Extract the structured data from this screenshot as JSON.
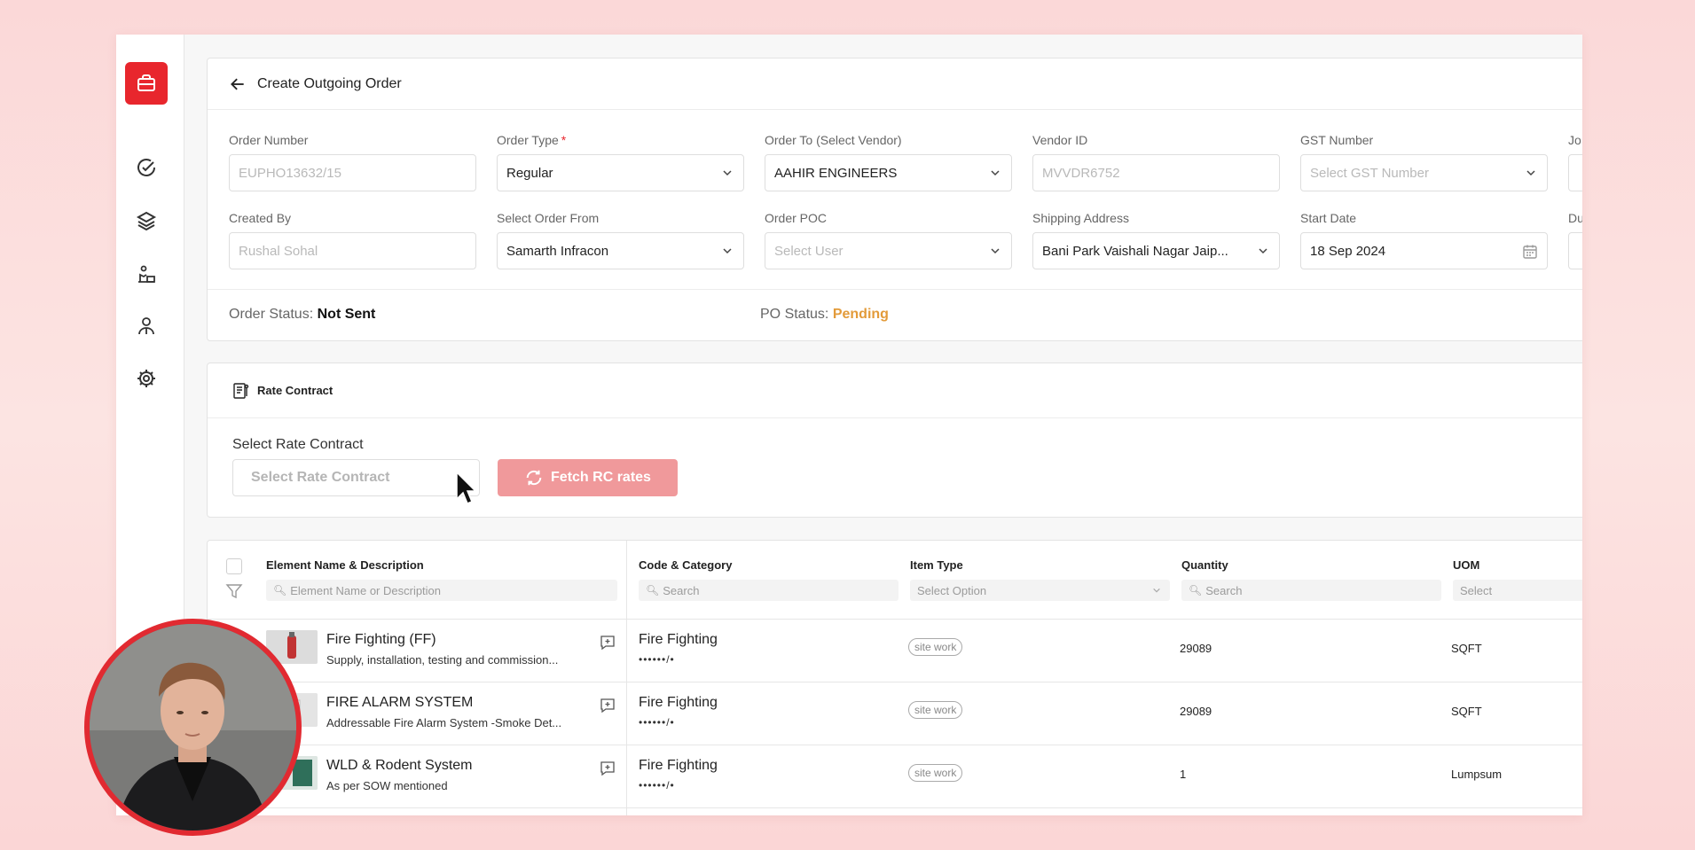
{
  "header": {
    "title": "Create Outgoing Order"
  },
  "form": {
    "order_number": {
      "label": "Order Number",
      "value": "EUPHO13632/15"
    },
    "order_type": {
      "label": "Order Type",
      "value": "Regular",
      "required_mark": "*"
    },
    "order_to": {
      "label": "Order To (Select Vendor)",
      "value": "AAHIR ENGINEERS"
    },
    "vendor_id": {
      "label": "Vendor ID",
      "value": "MVVDR6752"
    },
    "gst_number": {
      "label": "GST Number",
      "placeholder": "Select GST Number"
    },
    "created_by": {
      "label": "Created By",
      "value": "Rushal Sohal"
    },
    "order_from": {
      "label": "Select Order From",
      "value": "Samarth Infracon"
    },
    "order_poc": {
      "label": "Order POC",
      "placeholder": "Select User"
    },
    "shipping_address": {
      "label": "Shipping Address",
      "value": "Bani Park Vaishali Nagar Jaip..."
    },
    "start_date": {
      "label": "Start Date",
      "value": "18 Sep 2024"
    },
    "cut_label_1": "Jo",
    "cut_label_2": "Du"
  },
  "status": {
    "order_label": "Order Status:",
    "order_value": "Not Sent",
    "po_label": "PO Status:",
    "po_value": "Pending"
  },
  "rate_contract": {
    "title": "Rate Contract",
    "select_label": "Select Rate Contract",
    "select_placeholder": "Select Rate Contract",
    "fetch_button": "Fetch RC rates"
  },
  "table": {
    "columns": [
      {
        "label": "Element Name & Description",
        "filter": "Element Name or Description"
      },
      {
        "label": "Code & Category",
        "filter": "Search"
      },
      {
        "label": "Item Type",
        "filter": "Select Option"
      },
      {
        "label": "Quantity",
        "filter": "Search"
      },
      {
        "label": "UOM",
        "filter": "Select"
      }
    ],
    "rows": [
      {
        "name": "Fire Fighting (FF)",
        "desc": "Supply, installation, testing and commission...",
        "code": "Fire Fighting",
        "code_sub": "••••••/•",
        "type": "site work",
        "qty": "29089",
        "uom": "SQFT"
      },
      {
        "name": "FIRE ALARM SYSTEM",
        "desc": "Addressable Fire Alarm System -Smoke Det...",
        "code": "Fire Fighting",
        "code_sub": "••••••/•",
        "type": "site work",
        "qty": "29089",
        "uom": "SQFT"
      },
      {
        "name": "WLD & Rodent System",
        "desc": "As per SOW mentioned",
        "code": "Fire Fighting",
        "code_sub": "••••••/•",
        "type": "site work",
        "qty": "1",
        "uom": "Lumpsum"
      }
    ]
  },
  "colors": {
    "accent": "#e8262d",
    "fetch_button_bg": "#f0999b",
    "pending": "#e39b3a"
  },
  "icons": [
    "briefcase-icon",
    "check-circle-icon",
    "layers-icon",
    "worker-icon",
    "user-icon",
    "gear-icon",
    "back-arrow-icon",
    "rate-contract-icon",
    "refresh-icon",
    "chevron-down-icon",
    "calendar-icon",
    "comment-icon",
    "filter-icon"
  ]
}
